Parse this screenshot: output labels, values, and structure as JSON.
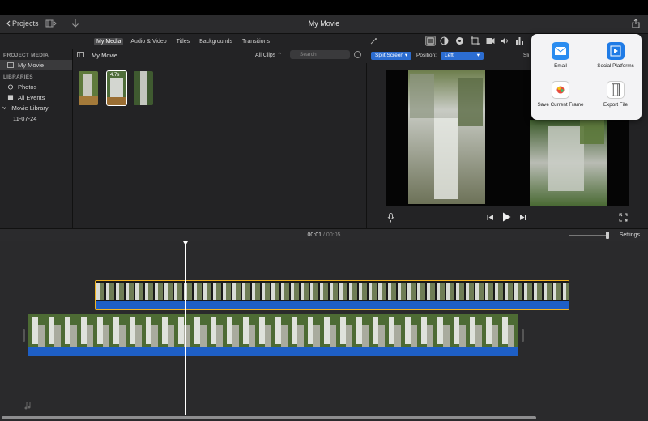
{
  "titlebar": {
    "back_label": "Projects",
    "title": "My Movie"
  },
  "media_tabs": [
    {
      "label": "My Media",
      "active": true
    },
    {
      "label": "Audio & Video",
      "active": false
    },
    {
      "label": "Titles",
      "active": false
    },
    {
      "label": "Backgrounds",
      "active": false
    },
    {
      "label": "Transitions",
      "active": false
    }
  ],
  "sidebar": {
    "section1": "PROJECT MEDIA",
    "project_item": "My Movie",
    "section2": "LIBRARIES",
    "items": [
      "Photos",
      "All Events",
      "iMovie Library",
      "11-07-24"
    ]
  },
  "browser": {
    "title": "My Movie",
    "filter": "All Clips",
    "search_placeholder": "Search",
    "thumb_duration": "4.7s"
  },
  "viewer": {
    "mode": "Split Screen",
    "position_label": "Position:",
    "position_value": "Left",
    "slider_label": "Sli"
  },
  "timeline": {
    "current": "00:01",
    "separator": "/",
    "total": "00:05",
    "settings_label": "Settings"
  },
  "share_menu": {
    "options": [
      {
        "label": "Email",
        "icon": "mail-icon"
      },
      {
        "label": "Social Platforms",
        "icon": "social-icon"
      },
      {
        "label": "Save Current Frame",
        "icon": "save-frame-icon"
      },
      {
        "label": "Export File",
        "icon": "export-file-icon"
      }
    ]
  },
  "colors": {
    "accent": "#2c6dd1",
    "audio": "#1e5fc6",
    "selection": "#f0b323"
  }
}
